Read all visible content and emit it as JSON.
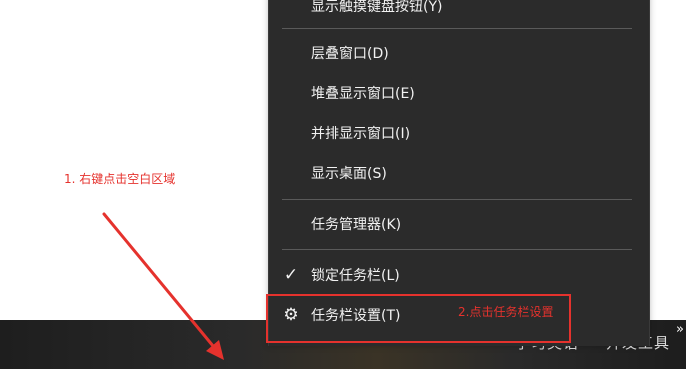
{
  "context_menu": {
    "items": [
      {
        "label": "显示触摸键盘按钮(Y)"
      },
      {
        "label": "层叠窗口(D)"
      },
      {
        "label": "堆叠显示窗口(E)"
      },
      {
        "label": "并排显示窗口(I)"
      },
      {
        "label": "显示桌面(S)"
      },
      {
        "label": "任务管理器(K)"
      },
      {
        "label": "锁定任务栏(L)",
        "checked": true,
        "check_mark": "✓"
      },
      {
        "label": "任务栏设置(T)",
        "icon": "gear-icon",
        "icon_glyph": "⚙"
      }
    ]
  },
  "taskbar": {
    "items": [
      {
        "label": "学习英语"
      },
      {
        "label": "开发工具"
      }
    ],
    "overflow_glyph": "»"
  },
  "annotations": {
    "step1": "1. 右键点击空白区域",
    "step2": "2.点击任务栏设置",
    "color": "#e5322d"
  },
  "colors": {
    "menu_bg": "#2b2b2b",
    "menu_text": "#f2f2f2",
    "separator": "#5a5a5a",
    "annotation": "#e5322d"
  }
}
